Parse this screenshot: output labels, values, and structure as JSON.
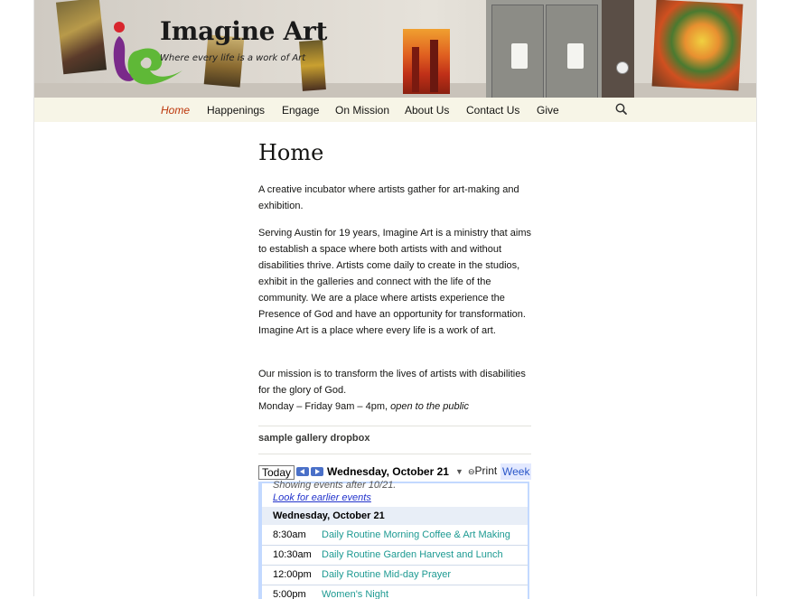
{
  "site": {
    "title": "Imagine Art",
    "tagline": "Where every life is a work of Art"
  },
  "nav": {
    "items": [
      {
        "label": "Home",
        "active": true
      },
      {
        "label": "Happenings",
        "active": false
      },
      {
        "label": "Engage",
        "active": false
      },
      {
        "label": "On Mission",
        "active": false
      },
      {
        "label": "About Us",
        "active": false
      },
      {
        "label": "Contact Us",
        "active": false
      },
      {
        "label": "Give",
        "active": false
      }
    ],
    "search_icon": "search-icon"
  },
  "page": {
    "title": "Home",
    "intro": "A creative incubator where artists gather for art-making and exhibition.",
    "about": "Serving Austin for 19 years, Imagine Art is a ministry that aims to establish a space where both artists with and without disabilities thrive. Artists come daily to create in the studios, exhibit in the galleries and connect with the life of the community. We are a place where artists experience the Presence of God and have an opportunity for transformation. Imagine Art is a place where every life is a work of art.",
    "mission": "Our mission is to transform the lives of artists with disabilities for the glory of God.",
    "hours": "Monday – Friday 9am – 4pm,",
    "hours_note": "open to the public"
  },
  "widget": {
    "title": "sample gallery dropbox"
  },
  "calendar": {
    "today_label": "Today",
    "date_label": "Wednesday, October 21",
    "print_label": "Print",
    "week_label": "Week",
    "showing_text": "Showing events after 10/21.",
    "earlier_link": "Look for earlier events",
    "day_heading": "Wednesday, October 21",
    "events": [
      {
        "time": "8:30am",
        "title": "Daily Routine Morning Coffee & Art Making"
      },
      {
        "time": "10:30am",
        "title": "Daily Routine Garden Harvest and Lunch"
      },
      {
        "time": "12:00pm",
        "title": "Daily Routine Mid-day Prayer"
      },
      {
        "time": "5:00pm",
        "title": "Women's Night"
      }
    ]
  },
  "colors": {
    "nav_bg": "#f7f5e7",
    "nav_active": "#bc360a",
    "calendar_border": "#c3d9ff",
    "event_title": "#1d9a92",
    "link": "#2233cc"
  }
}
